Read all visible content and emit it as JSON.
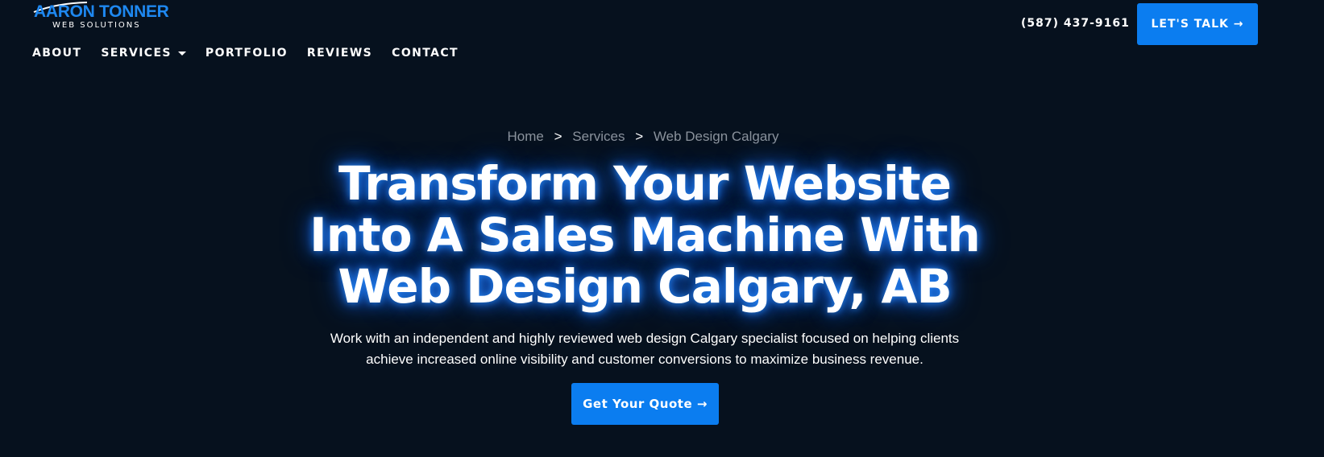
{
  "logo": {
    "name": "AARON TONNER",
    "subtitle": "WEB SOLUTIONS"
  },
  "nav": {
    "items": [
      {
        "label": "ABOUT"
      },
      {
        "label": "SERVICES"
      },
      {
        "label": "PORTFOLIO"
      },
      {
        "label": "REVIEWS"
      },
      {
        "label": "CONTACT"
      }
    ]
  },
  "header": {
    "phone": "(587) 437-9161",
    "cta_label": "LET'S TALK →"
  },
  "breadcrumb": {
    "items": [
      "Home",
      "Services",
      "Web Design Calgary"
    ],
    "separator": ">"
  },
  "hero": {
    "title_lines": [
      "Transform Your Website",
      "Into A Sales Machine With",
      "Web Design Calgary, AB"
    ],
    "description_lines": [
      "Work with an independent and highly reviewed web design Calgary specialist focused on helping clients",
      "achieve increased online visibility and customer conversions to maximize business revenue."
    ],
    "cta_label": "Get Your Quote →"
  },
  "colors": {
    "background": "#06111e",
    "accent": "#0b7df0",
    "logo_blue": "#1e88f0",
    "breadcrumb_gray": "#8a929c"
  },
  "icons": {
    "dropdown": "caret-down-icon",
    "logo_mark": "swoosh-icon"
  }
}
